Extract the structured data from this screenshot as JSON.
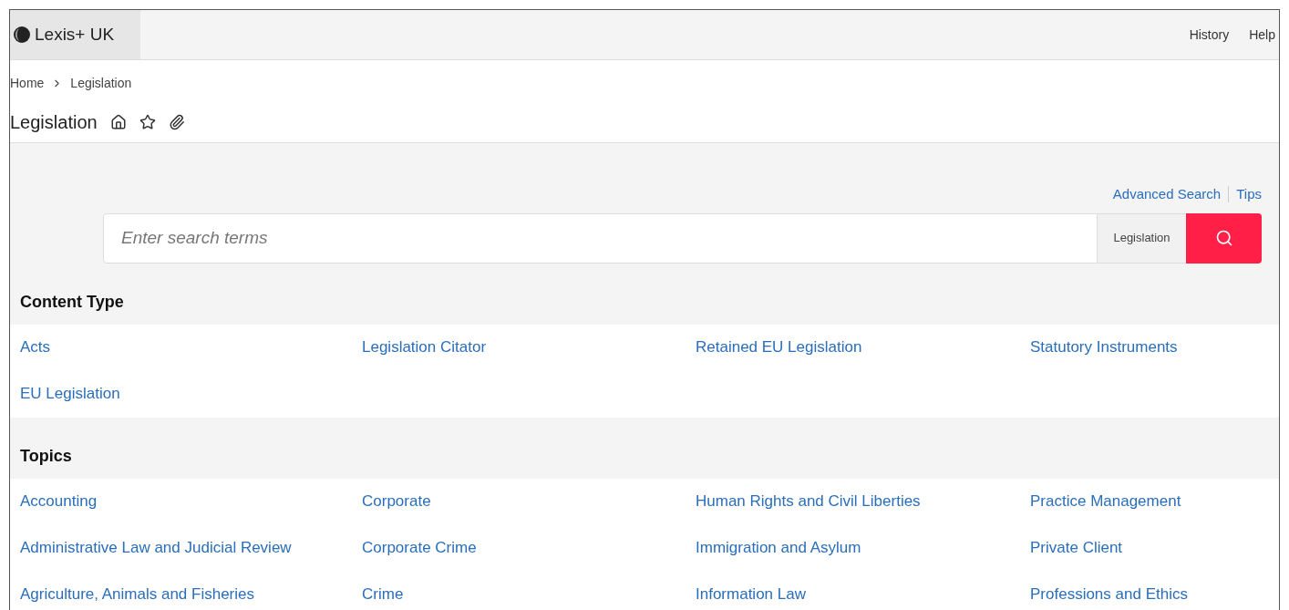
{
  "header": {
    "logo": "Lexis+ UK",
    "nav": [
      "History",
      "Help"
    ]
  },
  "breadcrumb": [
    "Home",
    "Legislation"
  ],
  "page_title": "Legislation",
  "search": {
    "links": [
      "Advanced Search",
      "Tips"
    ],
    "placeholder": "Enter search terms",
    "scope": "Legislation"
  },
  "sections": [
    {
      "title": "Content Type",
      "items": [
        "Acts",
        "Legislation Citator",
        "Retained EU Legislation",
        "Statutory Instruments",
        "EU Legislation"
      ]
    },
    {
      "title": "Topics",
      "items": [
        "Accounting",
        "Corporate",
        "Human Rights and Civil Liberties",
        "Practice Management",
        "Administrative Law and Judicial Review",
        "Corporate Crime",
        "Immigration and Asylum",
        "Private Client",
        "Agriculture, Animals and Fisheries",
        "Crime",
        "Information Law",
        "Professions and Ethics"
      ]
    }
  ]
}
